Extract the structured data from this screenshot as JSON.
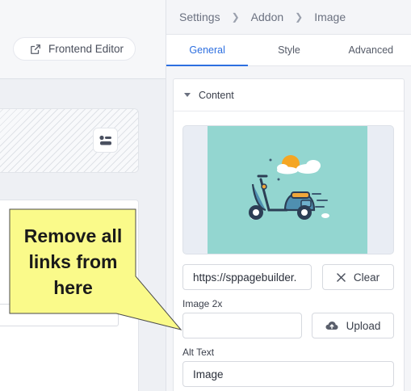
{
  "editor": {
    "frontend_label": "Frontend Editor",
    "frontend_icon": "external-edit-icon",
    "layout_icon": "layout-toggle-icon"
  },
  "breadcrumb": {
    "items": [
      "Settings",
      "Addon",
      "Image"
    ],
    "separator_icon": "chevron-right-icon"
  },
  "tabs": [
    {
      "label": "General",
      "active": true
    },
    {
      "label": "Style",
      "active": false
    },
    {
      "label": "Advanced",
      "active": false
    }
  ],
  "content_section": {
    "title": "Content",
    "collapse_icon": "caret-down-icon",
    "preview_image": "scooter-illustration",
    "url_value": "https://sppagebuilder.",
    "clear_label": "Clear",
    "clear_icon": "close-icon",
    "image2x_label": "Image 2x",
    "image2x_value": "",
    "upload_label": "Upload",
    "upload_icon": "cloud-upload-icon",
    "alt_label": "Alt Text",
    "alt_value": "Image"
  },
  "callout": {
    "lines": [
      "Remove all",
      "links from",
      "here"
    ],
    "fill_color": "#fafa8a"
  },
  "colors": {
    "accent": "#2d6fe0",
    "preview_bg": "#93d6d0"
  }
}
